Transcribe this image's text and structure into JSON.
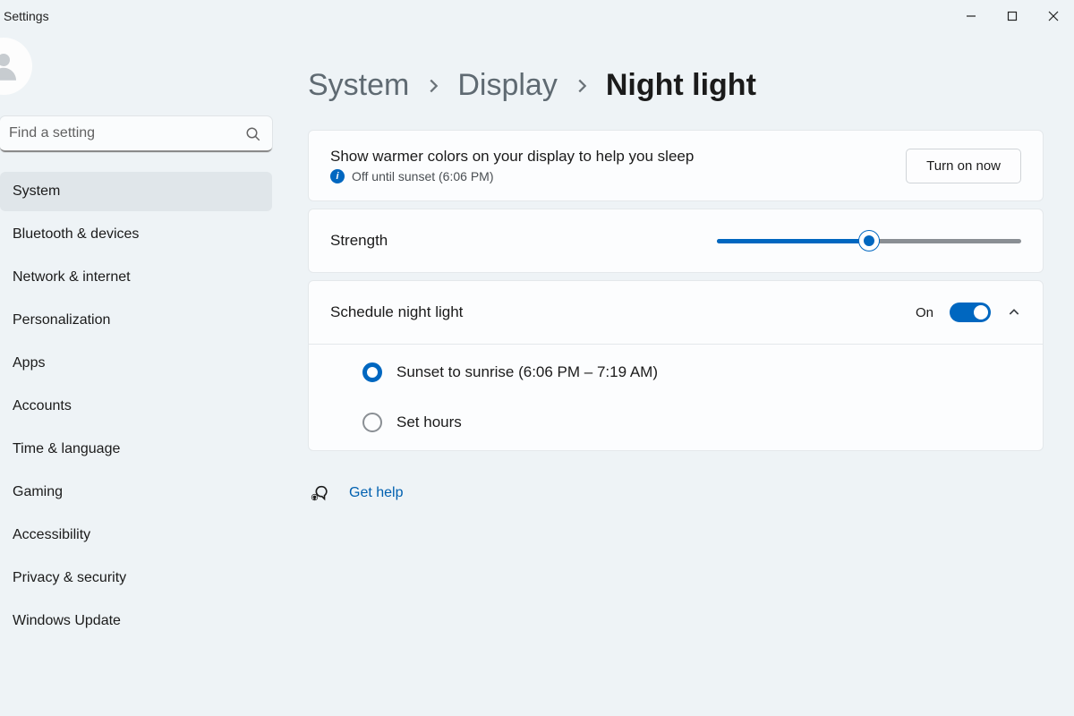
{
  "window": {
    "app_title": "Settings"
  },
  "search": {
    "placeholder": "Find a setting"
  },
  "sidebar": {
    "items": [
      {
        "label": "System",
        "active": true
      },
      {
        "label": "Bluetooth & devices",
        "active": false
      },
      {
        "label": "Network & internet",
        "active": false
      },
      {
        "label": "Personalization",
        "active": false
      },
      {
        "label": "Apps",
        "active": false
      },
      {
        "label": "Accounts",
        "active": false
      },
      {
        "label": "Time & language",
        "active": false
      },
      {
        "label": "Gaming",
        "active": false
      },
      {
        "label": "Accessibility",
        "active": false
      },
      {
        "label": "Privacy & security",
        "active": false
      },
      {
        "label": "Windows Update",
        "active": false
      }
    ]
  },
  "breadcrumb": {
    "0": "System",
    "1": "Display",
    "2": "Night light"
  },
  "intro": {
    "title": "Show warmer colors on your display to help you sleep",
    "status": "Off until sunset (6:06 PM)",
    "button": "Turn on now"
  },
  "strength": {
    "label": "Strength",
    "value_percent": 50
  },
  "schedule": {
    "label": "Schedule night light",
    "state_label": "On",
    "enabled": true,
    "options": {
      "sunset": "Sunset to sunrise (6:06 PM – 7:19 AM)",
      "set_hours": "Set hours"
    },
    "selected": "sunset"
  },
  "help": {
    "label": "Get help"
  }
}
